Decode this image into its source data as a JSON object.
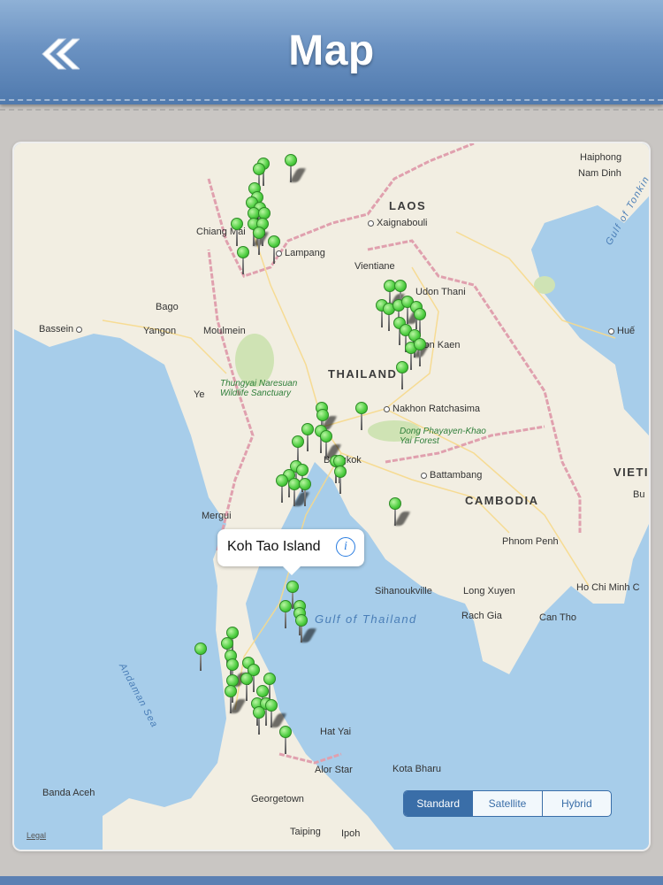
{
  "header": {
    "title": "Map",
    "back_icon": "double-chevron-left-icon"
  },
  "map": {
    "labels": {
      "haiphong": "Haiphong",
      "nam_dinh": "Nam Dinh",
      "gulf_tonkin": "Gulf of Tonkin",
      "laos": "LAOS",
      "xaignabouli": "Xaignabouli",
      "chiang_mai": "Chiang Mai",
      "lampang": "Lampang",
      "vientiane": "Vientiane",
      "udon_thani": "Udon Thani",
      "bago": "Bago",
      "bassein": "Bassein",
      "yangon": "Yangon",
      "moulmein": "Moulmein",
      "hue": "Huế",
      "khon_kaen": "Khon Kaen",
      "thailand": "THAILAND",
      "thungyai": "Thungyai Naresuan Wildlife Sanctuary",
      "ye": "Ye",
      "nakhon": "Nakhon Ratchasima",
      "dong": "Dong Phayayen-Khao Yai Forest",
      "bangkok": "Bangkok",
      "battambang": "Battambang",
      "vieti": "VIETI",
      "cambodia": "CAMBODIA",
      "mergui": "Mergui",
      "phnom_penh": "Phnom Penh",
      "sihanoukville": "Sihanoukville",
      "long_xuyen": "Long Xuyen",
      "ho_chi_minh": "Ho Chi Minh C",
      "gulf_thailand": "Gulf of Thailand",
      "rach_gia": "Rach Gia",
      "can_tho": "Can Tho",
      "andaman": "Andaman Sea",
      "hat_yai": "Hat Yai",
      "kota_bharu": "Kota Bharu",
      "alor_star": "Alor Star",
      "banda_aceh": "Banda Aceh",
      "georgetown": "Georgetown",
      "taiping": "Taiping",
      "ipoh": "Ipoh",
      "legal": "Legal",
      "bu": "Bu"
    },
    "callout": {
      "title": "Koh Tao Island",
      "info_icon": "info-icon"
    },
    "map_types": [
      "Standard",
      "Satellite",
      "Hybrid"
    ],
    "selected_map_type": "Standard",
    "pin_color": "#4ccd3f"
  }
}
